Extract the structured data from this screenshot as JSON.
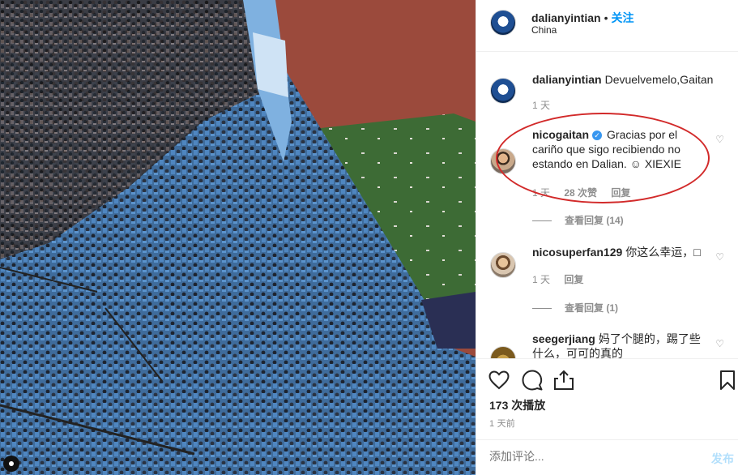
{
  "header": {
    "username": "dalianyintian",
    "dot": "•",
    "follow": "关注",
    "location": "China"
  },
  "comments": [
    {
      "username": "dalianyintian",
      "text": "Devuelvemelo,Gaitan",
      "time": "1 天"
    },
    {
      "username": "nicogaitan",
      "verified": true,
      "text": "Gracias por el cariño que sigo recibiendo no estando en Dalian. ☺ XIEXIE",
      "time": "1 天",
      "likes": "28 次赞",
      "reply": "回复",
      "view_replies": "查看回复 (14)"
    },
    {
      "username": "nicosuperfan129",
      "text": "你这么幸运，□",
      "time": "1 天",
      "reply": "回复",
      "view_replies": "查看回复 (1)"
    },
    {
      "username": "seegerjiang",
      "text": "妈了个腿的，踢了些什么，可可的真的"
    }
  ],
  "actions": {
    "views": "173 次播放",
    "time": "1 天前"
  },
  "add_comment": {
    "placeholder": "添加评论...",
    "post": "发布"
  },
  "icons": [
    "heart-icon",
    "comment-icon",
    "share-icon",
    "bookmark-icon",
    "sound-icon",
    "verified-icon"
  ]
}
